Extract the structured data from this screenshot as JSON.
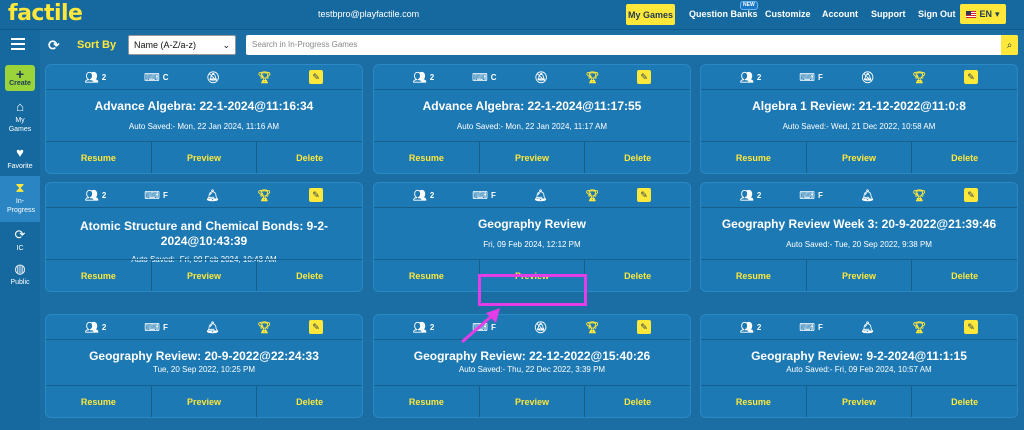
{
  "header": {
    "logo": "factile",
    "email": "testbpro@playfactile.com",
    "my_games": "My Games",
    "question_banks": "Question Banks",
    "new_badge": "NEW",
    "customize": "Customize",
    "account": "Account",
    "support": "Support",
    "sign_out": "Sign Out",
    "language": "EN"
  },
  "sidebar": {
    "create": "Create",
    "items": [
      {
        "label": "My Games",
        "icon": "home-icon"
      },
      {
        "label": "Favorite",
        "icon": "heart-icon"
      },
      {
        "label": "In-Progress",
        "icon": "hourglass-icon"
      },
      {
        "label": "IC",
        "icon": "refresh-circle-icon"
      },
      {
        "label": "Public",
        "icon": "globe-icon"
      }
    ]
  },
  "filters": {
    "sort_by": "Sort By",
    "sort_value": "Name (A-Z/a-z)",
    "search_placeholder": "Search in In-Progress Games"
  },
  "actions": {
    "resume": "Resume",
    "preview": "Preview",
    "delete": "Delete"
  },
  "cards": [
    {
      "teams": "2",
      "mode": "C",
      "title": "Advance Algebra: 22-1-2024@11:16:34",
      "sub": "Auto Saved:- Mon, 22 Jan 2024, 11:16 AM"
    },
    {
      "teams": "2",
      "mode": "C",
      "title": "Advance Algebra: 22-1-2024@11:17:55",
      "sub": "Auto Saved:- Mon, 22 Jan 2024, 11:17 AM"
    },
    {
      "teams": "2",
      "mode": "F",
      "title": "Algebra 1 Review: 21-12-2022@11:0:8",
      "sub": "Auto Saved:- Wed, 21 Dec 2022, 10:58 AM"
    },
    {
      "teams": "2",
      "mode": "F",
      "title": "Atomic Structure and Chemical Bonds: 9-2-2024@10:43:39",
      "sub": "Auto Saved:- Fri, 09 Feb 2024, 10:43 AM"
    },
    {
      "teams": "2",
      "mode": "F",
      "title": "Geography Review",
      "sub": "Fri, 09 Feb 2024, 12:12 PM"
    },
    {
      "teams": "2",
      "mode": "F",
      "title": "Geography Review Week 3: 20-9-2022@21:39:46",
      "sub": "Auto Saved:- Tue, 20 Sep 2022, 9:38 PM"
    },
    {
      "teams": "2",
      "mode": "F",
      "title": "Geography Review: 20-9-2022@22:24:33",
      "sub": "Tue, 20 Sep 2022, 10:25 PM"
    },
    {
      "teams": "2",
      "mode": "F",
      "title": "Geography Review: 22-12-2022@15:40:26",
      "sub": "Auto Saved:- Thu, 22 Dec 2022, 3:39 PM"
    },
    {
      "teams": "2",
      "mode": "F",
      "title": "Geography Review: 9-2-2024@11:1:15",
      "sub": "Auto Saved:- Fri, 09 Feb 2024, 10:57 AM"
    }
  ],
  "colors": {
    "accent": "#ffe83a",
    "background": "#1a6ea3",
    "card": "#1d79b3",
    "highlight": "#e23de6"
  }
}
